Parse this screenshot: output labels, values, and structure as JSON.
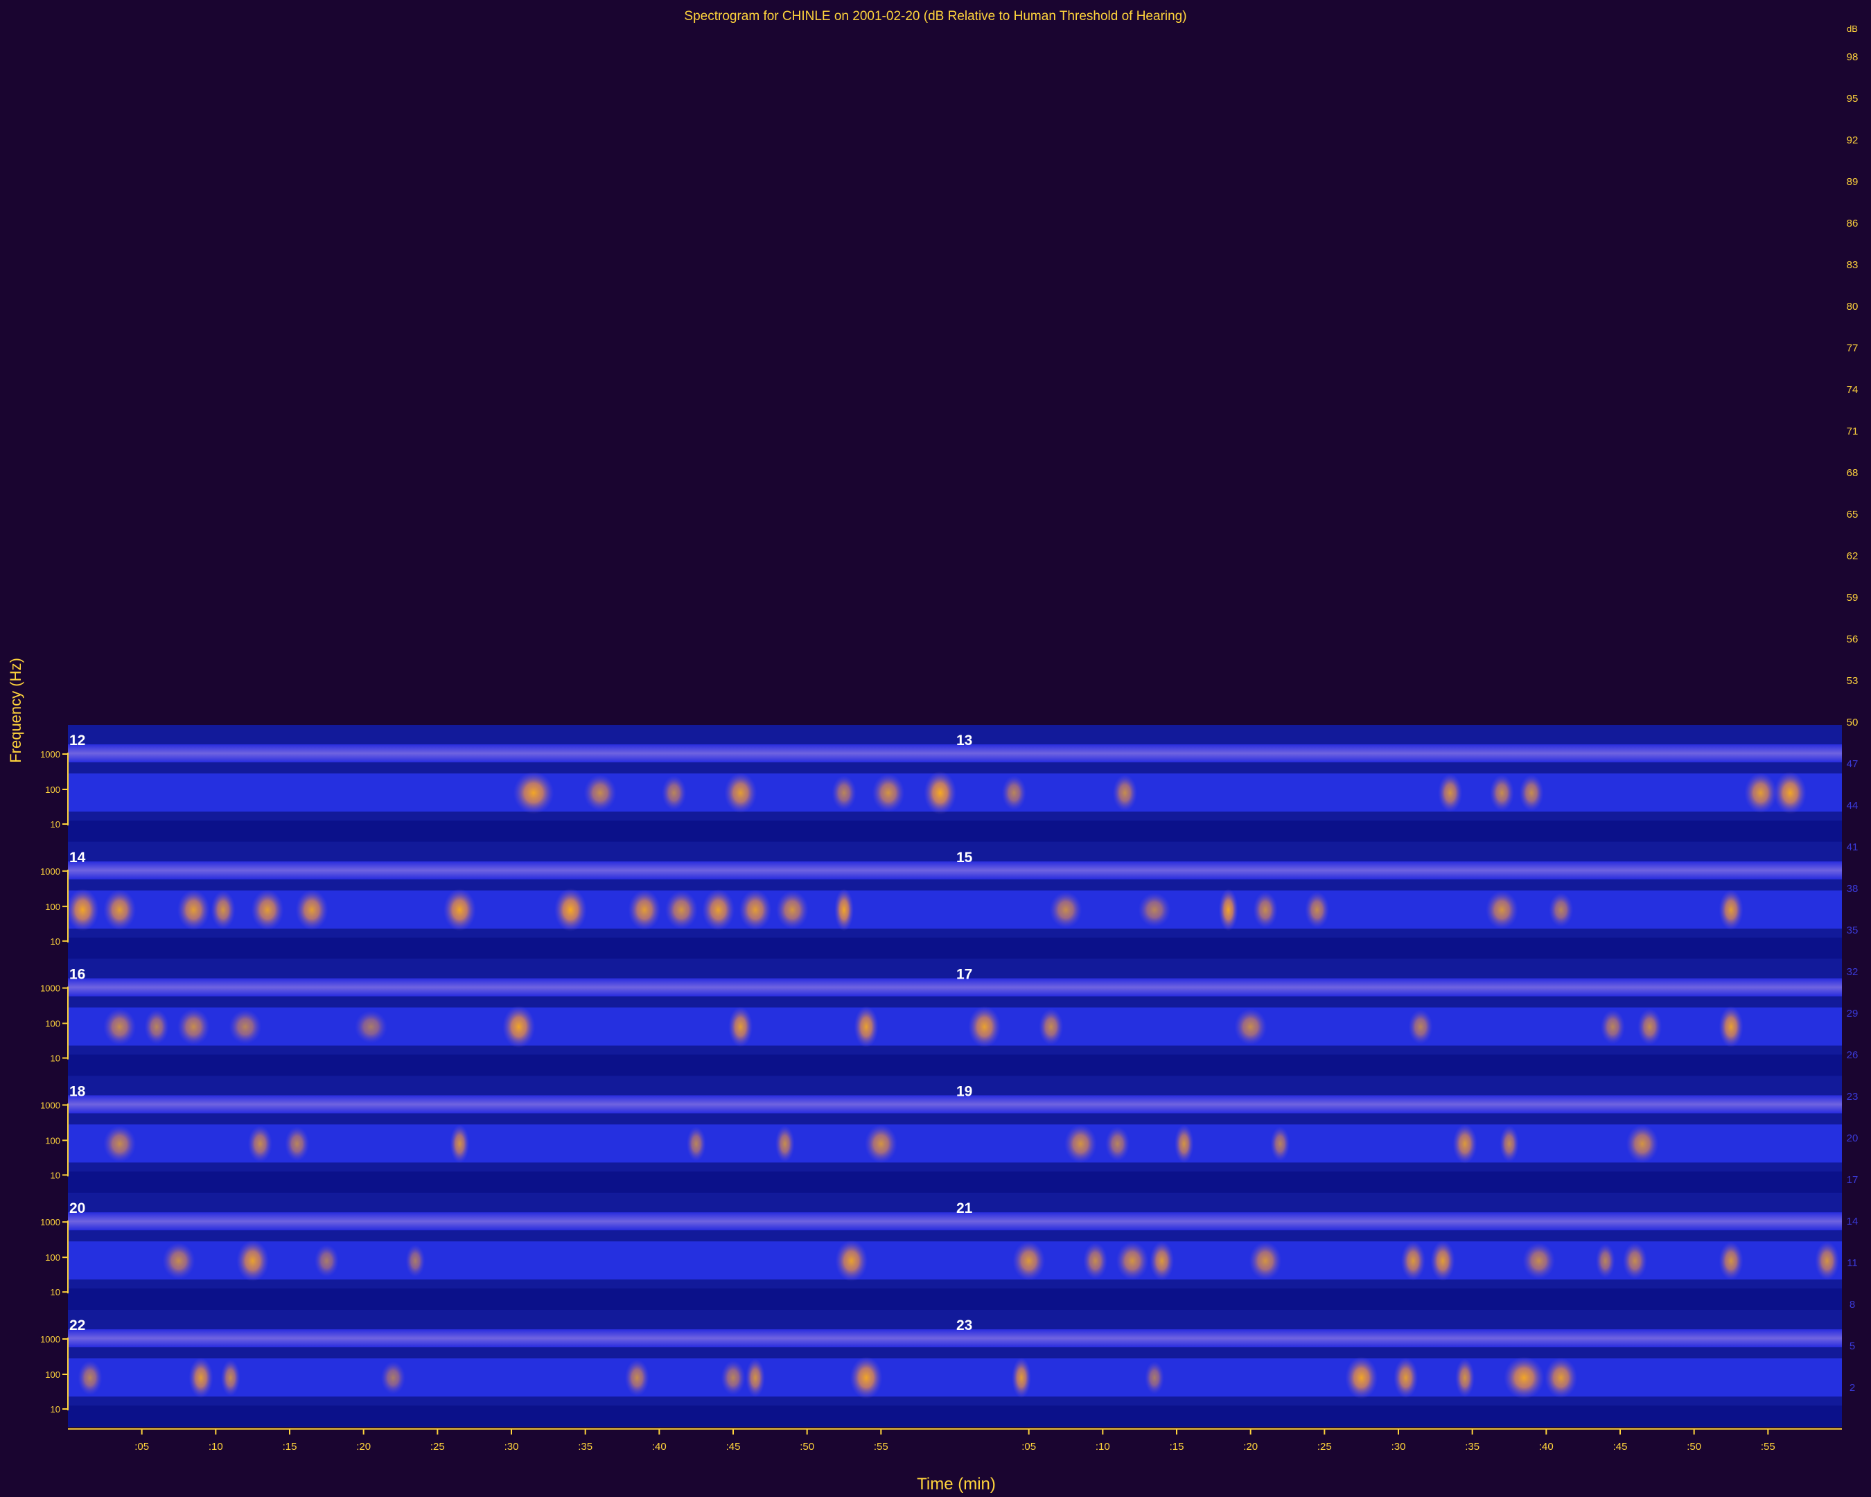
{
  "chart_data": {
    "type": "heatmap",
    "title": "Spectrogram for CHINLE on 2001-02-20 (dB Relative to Human Threshold of Hearing)",
    "xlabel": "Time (min)",
    "ylabel": "Frequency (Hz)",
    "ytick_labels": [
      "1000",
      "100",
      "10"
    ],
    "x_tick_labels": [
      ":05",
      ":10",
      ":15",
      ":20",
      ":25",
      ":30",
      ":35",
      ":40",
      ":45",
      ":50",
      ":55",
      ":05",
      ":10",
      ":15",
      ":20",
      ":25",
      ":30",
      ":35",
      ":40",
      ":45",
      ":50",
      ":55"
    ],
    "colorbar": {
      "unit": "dB",
      "ticks": [
        98,
        95,
        92,
        89,
        86,
        83,
        80,
        77,
        74,
        71,
        68,
        65,
        62,
        59,
        56,
        53,
        50,
        47,
        44,
        41,
        38,
        35,
        32,
        29,
        26,
        23,
        20,
        17,
        14,
        11,
        8,
        5,
        2
      ],
      "range": [
        0,
        100
      ],
      "colors": {
        "low": "#1a0530",
        "mid": "#1e2be0",
        "high": "#ffae1a",
        "labels_high": "#ffd43c",
        "labels_low": "#3a3ad8"
      }
    },
    "hours": [
      {
        "label": "12",
        "events": [
          [
            31.5,
            2.5,
            0.9
          ],
          [
            36,
            2,
            0.6
          ],
          [
            41,
            1.5,
            0.5
          ],
          [
            45.5,
            2,
            0.8
          ],
          [
            52.5,
            1.5,
            0.5
          ],
          [
            55.5,
            2,
            0.7
          ],
          [
            59,
            2,
            0.95
          ]
        ]
      },
      {
        "label": "13",
        "events": [
          [
            4,
            1.5,
            0.5
          ],
          [
            11.5,
            1.5,
            0.6
          ],
          [
            33.5,
            1.5,
            0.7
          ],
          [
            37,
            1.5,
            0.6
          ],
          [
            39,
            1.5,
            0.6
          ],
          [
            54.5,
            2,
            0.8
          ],
          [
            56.5,
            2,
            0.9
          ]
        ]
      },
      {
        "label": "14",
        "events": [
          [
            1,
            2,
            0.9
          ],
          [
            3.5,
            2,
            0.8
          ],
          [
            8.5,
            2,
            0.8
          ],
          [
            10.5,
            1.5,
            0.7
          ],
          [
            13.5,
            2,
            0.8
          ],
          [
            16.5,
            2,
            0.8
          ],
          [
            26.5,
            2,
            0.9
          ],
          [
            34,
            2,
            0.95
          ],
          [
            39,
            2,
            0.8
          ],
          [
            41.5,
            2,
            0.7
          ],
          [
            44,
            2,
            0.85
          ],
          [
            46.5,
            2,
            0.8
          ],
          [
            49,
            2,
            0.7
          ],
          [
            52.5,
            0.5,
            0.9
          ]
        ]
      },
      {
        "label": "15",
        "events": [
          [
            7.5,
            2,
            0.6
          ],
          [
            13.5,
            2,
            0.5
          ],
          [
            18.5,
            1,
            0.9
          ],
          [
            21,
            1.5,
            0.6
          ],
          [
            24.5,
            1.5,
            0.6
          ],
          [
            37,
            2,
            0.7
          ],
          [
            41,
            1.5,
            0.5
          ],
          [
            52.5,
            1.5,
            0.8
          ]
        ]
      },
      {
        "label": "16",
        "events": [
          [
            3.5,
            2,
            0.6
          ],
          [
            6,
            1.5,
            0.5
          ],
          [
            8.5,
            2,
            0.6
          ],
          [
            12,
            2,
            0.5
          ],
          [
            20.5,
            2,
            0.4
          ],
          [
            30.5,
            2,
            0.9
          ],
          [
            45.5,
            1.5,
            0.8
          ],
          [
            54,
            1.5,
            0.85
          ]
        ]
      },
      {
        "label": "17",
        "events": [
          [
            2,
            2,
            0.85
          ],
          [
            6.5,
            1.5,
            0.6
          ],
          [
            20,
            2,
            0.6
          ],
          [
            31.5,
            1.5,
            0.5
          ],
          [
            44.5,
            1.5,
            0.5
          ],
          [
            47,
            1.5,
            0.6
          ],
          [
            52.5,
            1.5,
            0.85
          ]
        ]
      },
      {
        "label": "18",
        "events": [
          [
            3.5,
            2,
            0.6
          ],
          [
            13,
            1.5,
            0.6
          ],
          [
            15.5,
            1.5,
            0.5
          ],
          [
            26.5,
            1,
            0.7
          ],
          [
            42.5,
            1,
            0.5
          ],
          [
            48.5,
            1,
            0.6
          ],
          [
            55,
            2,
            0.7
          ]
        ]
      },
      {
        "label": "19",
        "events": [
          [
            8.5,
            2,
            0.7
          ],
          [
            11,
            1.5,
            0.5
          ],
          [
            15.5,
            1,
            0.7
          ],
          [
            22,
            1,
            0.5
          ],
          [
            34.5,
            1.5,
            0.75
          ],
          [
            37.5,
            0.5,
            0.6
          ],
          [
            46.5,
            2,
            0.7
          ]
        ]
      },
      {
        "label": "20",
        "events": [
          [
            7.5,
            2,
            0.6
          ],
          [
            12.5,
            2,
            0.85
          ],
          [
            17.5,
            1.5,
            0.4
          ],
          [
            23.5,
            1,
            0.4
          ],
          [
            53,
            2,
            0.85
          ]
        ]
      },
      {
        "label": "21",
        "events": [
          [
            5,
            2,
            0.75
          ],
          [
            9.5,
            1.5,
            0.6
          ],
          [
            12,
            2,
            0.7
          ],
          [
            14,
            1.5,
            0.75
          ],
          [
            21,
            2,
            0.7
          ],
          [
            31,
            1.5,
            0.75
          ],
          [
            33,
            1.5,
            0.8
          ],
          [
            39.5,
            2,
            0.6
          ],
          [
            44,
            1,
            0.5
          ],
          [
            46,
            1.5,
            0.6
          ],
          [
            52.5,
            1.5,
            0.7
          ],
          [
            59,
            1.5,
            0.7
          ]
        ]
      },
      {
        "label": "22",
        "events": [
          [
            1.5,
            1.5,
            0.5
          ],
          [
            9,
            1.5,
            0.8
          ],
          [
            11,
            1,
            0.6
          ],
          [
            22,
            1.5,
            0.4
          ],
          [
            38.5,
            1.5,
            0.6
          ],
          [
            45,
            1.5,
            0.5
          ],
          [
            46.5,
            1,
            0.7
          ],
          [
            54,
            2,
            0.9
          ]
        ]
      },
      {
        "label": "23",
        "events": [
          [
            4.5,
            1,
            0.8
          ],
          [
            13.5,
            0.5,
            0.4
          ],
          [
            27.5,
            2,
            0.9
          ],
          [
            30.5,
            1.5,
            0.8
          ],
          [
            34.5,
            1,
            0.7
          ],
          [
            38.5,
            2.5,
            0.9
          ],
          [
            41,
            2,
            0.8
          ]
        ]
      }
    ]
  }
}
